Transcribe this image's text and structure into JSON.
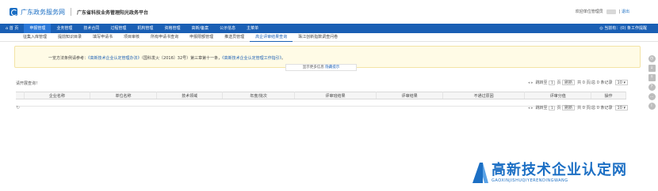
{
  "header": {
    "portal_name": "广东政务服务网",
    "system_title": "广东省科技业务管理阳光政务平台",
    "welcome": "欢迎单位管理员",
    "logout": "退出"
  },
  "main_nav": {
    "items": [
      {
        "label": "首 页",
        "active": false
      },
      {
        "label": "申报管理",
        "active": true
      },
      {
        "label": "业务管理",
        "active": false
      },
      {
        "label": "技术合同",
        "active": false
      },
      {
        "label": "过程管理",
        "active": false
      },
      {
        "label": "机构管理",
        "active": false
      },
      {
        "label": "资格管理",
        "active": false
      },
      {
        "label": "高新/备案",
        "active": false
      },
      {
        "label": "公示信息",
        "active": false
      },
      {
        "label": "主菜单",
        "active": false
      }
    ],
    "right_text": "◎ 当前有：(0) 条工作提醒"
  },
  "sub_nav": {
    "items": [
      {
        "label": "征集入库管理",
        "active": false
      },
      {
        "label": "提前知识目录",
        "active": false
      },
      {
        "label": "填写申请书",
        "active": false
      },
      {
        "label": "项目审核",
        "active": false
      },
      {
        "label": "所有申请书查询",
        "active": false
      },
      {
        "label": "申报限额管理",
        "active": false
      },
      {
        "label": "推送员管理",
        "active": false
      },
      {
        "label": "高企评审结果查询",
        "active": true
      },
      {
        "label": "珠江创新指数调查问卷",
        "active": false
      }
    ]
  },
  "notice": {
    "prefix": "一览方法条例请参考：",
    "link1": "《高新技术企业认定管理办法》",
    "middle": "（国科发火〔2016〕32号）第三章第十一条，",
    "link2": "《高新技术企业认定管理工作指引》",
    "suffix": "。",
    "expand_prefix": "显示更多信息",
    "expand_link": "隐藏提示"
  },
  "query_hint": "请开展查询！",
  "pager": {
    "goto_label": "跳转至",
    "page": "1",
    "page_unit": "页",
    "refresh": "刷新",
    "summary": "共 0 页/总 0 条记录",
    "page_size": "10"
  },
  "table": {
    "columns": [
      "企业名称",
      "单位名称",
      "技术领域",
      "年度/批次",
      "评审班结果",
      "评审结果",
      "不通过原因",
      "评审分值",
      "操作"
    ]
  },
  "side_tools": [
    "clock-icon",
    "download-icon",
    "upload-icon",
    "help-icon",
    "chat-icon",
    "info-icon"
  ],
  "watermark": {
    "main": "高新技术企业认定网",
    "sub": "GAOXINJISHUQIYERENDINGWANG"
  }
}
